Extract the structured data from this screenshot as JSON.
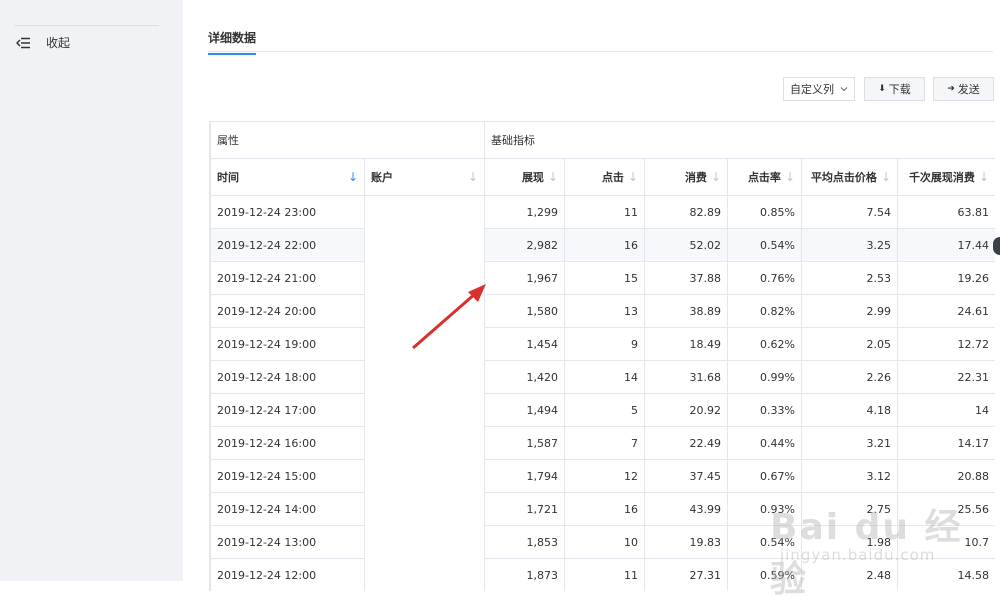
{
  "sidebar": {
    "collapse_label": "收起",
    "collapse_icon": "collapse-menu-icon"
  },
  "tabs": [
    {
      "label": "详细数据",
      "active": true
    }
  ],
  "toolbar": {
    "custom_columns_label": "自定义列",
    "download_label": "下载",
    "send_label": "发送"
  },
  "table": {
    "groups": [
      {
        "label": "属性"
      },
      {
        "label": "基础指标"
      }
    ],
    "columns": [
      {
        "label": "时间",
        "sorted": true
      },
      {
        "label": "账户"
      },
      {
        "label": "展现"
      },
      {
        "label": "点击"
      },
      {
        "label": "消费"
      },
      {
        "label": "点击率"
      },
      {
        "label": "平均点击价格"
      },
      {
        "label": "千次展现消费"
      }
    ],
    "rows": [
      [
        "2019-12-24 23:00",
        "",
        "1,299",
        "11",
        "82.89",
        "0.85%",
        "7.54",
        "63.81"
      ],
      [
        "2019-12-24 22:00",
        "",
        "2,982",
        "16",
        "52.02",
        "0.54%",
        "3.25",
        "17.44"
      ],
      [
        "2019-12-24 21:00",
        "",
        "1,967",
        "15",
        "37.88",
        "0.76%",
        "2.53",
        "19.26"
      ],
      [
        "2019-12-24 20:00",
        "",
        "1,580",
        "13",
        "38.89",
        "0.82%",
        "2.99",
        "24.61"
      ],
      [
        "2019-12-24 19:00",
        "",
        "1,454",
        "9",
        "18.49",
        "0.62%",
        "2.05",
        "12.72"
      ],
      [
        "2019-12-24 18:00",
        "",
        "1,420",
        "14",
        "31.68",
        "0.99%",
        "2.26",
        "22.31"
      ],
      [
        "2019-12-24 17:00",
        "",
        "1,494",
        "5",
        "20.92",
        "0.33%",
        "4.18",
        "14"
      ],
      [
        "2019-12-24 16:00",
        "",
        "1,587",
        "7",
        "22.49",
        "0.44%",
        "3.21",
        "14.17"
      ],
      [
        "2019-12-24 15:00",
        "",
        "1,794",
        "12",
        "37.45",
        "0.67%",
        "3.12",
        "20.88"
      ],
      [
        "2019-12-24 14:00",
        "",
        "1,721",
        "16",
        "43.99",
        "0.93%",
        "2.75",
        "25.56"
      ],
      [
        "2019-12-24 13:00",
        "",
        "1,853",
        "10",
        "19.83",
        "0.54%",
        "1.98",
        "10.7"
      ],
      [
        "2019-12-24 12:00",
        "",
        "1,873",
        "11",
        "27.31",
        "0.59%",
        "2.48",
        "14.58"
      ]
    ]
  },
  "watermark": {
    "brand": "Bai du 经验",
    "url": "jingyan.baidu.com"
  },
  "colors": {
    "accent": "#2d8cf0",
    "sidebar_bg": "#f0f2f5",
    "annotation_arrow": "#d9302c"
  }
}
